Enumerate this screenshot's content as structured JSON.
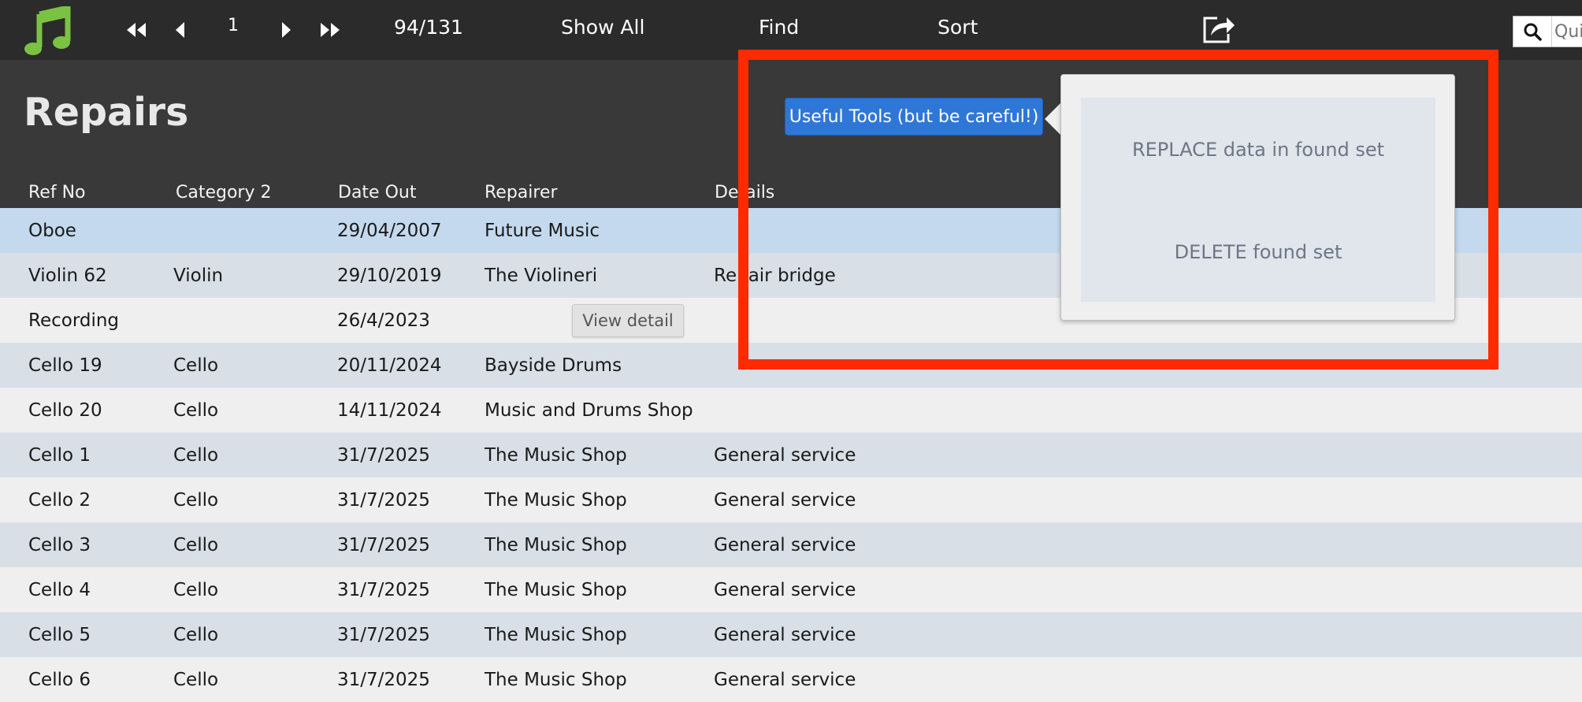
{
  "toolbar": {
    "record_number": "1",
    "record_count": "94/131",
    "show_all_label": "Show All",
    "find_label": "Find",
    "sort_label": "Sort",
    "search_placeholder": "Quick Find",
    "icons": [
      "music-note-icon",
      "first-record-icon",
      "previous-record-icon",
      "next-record-icon",
      "last-record-icon",
      "share-icon",
      "search-icon"
    ],
    "logo_color": "#7cc242"
  },
  "header": {
    "title": "Repairs",
    "tools_button_label": "Useful Tools (but be careful!)",
    "tools_button_color": "#2f77d6",
    "columns": [
      "Ref No",
      "Category 2",
      "Date Out",
      "Repairer",
      "Details"
    ]
  },
  "popover": {
    "replace_label": "REPLACE data in found set",
    "delete_label": "DELETE found set"
  },
  "view_detail_label": "View detail",
  "highlight_color": "#ff2a00",
  "rows": [
    {
      "ref": "Oboe",
      "category": "",
      "date": "29/04/2007",
      "repairer": "Future Music",
      "details": ""
    },
    {
      "ref": "Violin 62",
      "category": "Violin",
      "date": "29/10/2019",
      "repairer": "The Violineri",
      "details": "Repair bridge"
    },
    {
      "ref": "Recording",
      "category": "",
      "date": "26/4/2023",
      "repairer": "",
      "details": ""
    },
    {
      "ref": "Cello 19",
      "category": "Cello",
      "date": "20/11/2024",
      "repairer": "Bayside Drums",
      "details": ""
    },
    {
      "ref": "Cello 20",
      "category": "Cello",
      "date": "14/11/2024",
      "repairer": "Music and Drums Shop",
      "details": ""
    },
    {
      "ref": "Cello 1",
      "category": "Cello",
      "date": "31/7/2025",
      "repairer": "The Music Shop",
      "details": "General service"
    },
    {
      "ref": "Cello 2",
      "category": "Cello",
      "date": "31/7/2025",
      "repairer": "The Music Shop",
      "details": "General service"
    },
    {
      "ref": "Cello 3",
      "category": "Cello",
      "date": "31/7/2025",
      "repairer": "The Music Shop",
      "details": "General service"
    },
    {
      "ref": "Cello 4",
      "category": "Cello",
      "date": "31/7/2025",
      "repairer": "The Music Shop",
      "details": "General service"
    },
    {
      "ref": "Cello 5",
      "category": "Cello",
      "date": "31/7/2025",
      "repairer": "The Music Shop",
      "details": "General service"
    },
    {
      "ref": "Cello 6",
      "category": "Cello",
      "date": "31/7/2025",
      "repairer": "The Music Shop",
      "details": "General service"
    }
  ],
  "row_colors": {
    "selected": "#c4d9ee",
    "alt": "#d8dfe6",
    "plain": "#efefef"
  }
}
